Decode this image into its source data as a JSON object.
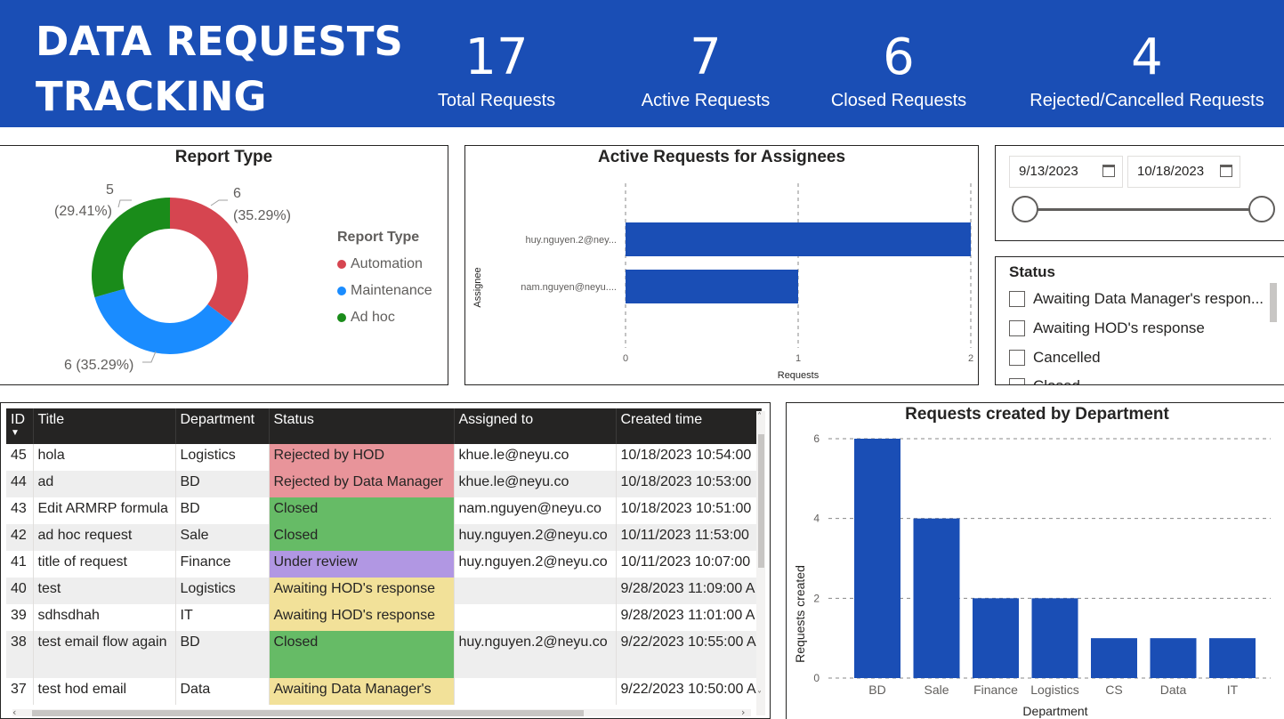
{
  "header": {
    "title_line1": "DATA REQUESTS",
    "title_line2": "TRACKING",
    "bg_color": "#1A4EB5",
    "kpis": [
      {
        "value": "17",
        "label": "Total Requests"
      },
      {
        "value": "7",
        "label": "Active Requests"
      },
      {
        "value": "6",
        "label": "Closed Requests"
      },
      {
        "value": "4",
        "label": "Rejected/Cancelled Requests"
      }
    ]
  },
  "report_type": {
    "title": "Report Type",
    "legend_title": "Report Type",
    "legend": [
      {
        "label": "Automation",
        "color": "#D64550"
      },
      {
        "label": "Maintenance",
        "color": "#1A8CFF"
      },
      {
        "label": "Ad hoc",
        "color": "#1A8C1A"
      }
    ],
    "callouts": {
      "automation_count": "6",
      "automation_pct": "(35.29%)",
      "maintenance": "6 (35.29%)",
      "adhoc_count": "5",
      "adhoc_pct": "(29.41%)"
    }
  },
  "assignees_chart": {
    "title": "Active Requests for Assignees",
    "ylabel": "Assignee",
    "xlabel": "Requests"
  },
  "date_slicer": {
    "start": "9/13/2023",
    "end": "10/18/2023",
    "icon": "calendar-icon"
  },
  "status_slicer": {
    "title": "Status",
    "items": [
      "Awaiting Data Manager's respon...",
      "Awaiting HOD's response",
      "Cancelled",
      "Closed"
    ]
  },
  "table": {
    "columns": [
      "ID",
      "Title",
      "Department",
      "Status",
      "Assigned to",
      "Created time"
    ],
    "rows": [
      {
        "id": "45",
        "title": "hola",
        "dept": "Logistics",
        "status": "Rejected by HOD",
        "status_color": "#E8949A",
        "assigned": "khue.le@neyu.co",
        "created": "10/18/2023 10:54:00"
      },
      {
        "id": "44",
        "title": "ad",
        "dept": "BD",
        "status": "Rejected by Data Manager",
        "status_color": "#E8949A",
        "assigned": "khue.le@neyu.co",
        "created": "10/18/2023 10:53:00"
      },
      {
        "id": "43",
        "title": "Edit ARMRP formula",
        "dept": "BD",
        "status": "Closed",
        "status_color": "#66BB66",
        "assigned": "nam.nguyen@neyu.co",
        "created": "10/18/2023 10:51:00"
      },
      {
        "id": "42",
        "title": "ad hoc request",
        "dept": "Sale",
        "status": "Closed",
        "status_color": "#66BB66",
        "assigned": "huy.nguyen.2@neyu.co",
        "created": "10/11/2023 11:53:00"
      },
      {
        "id": "41",
        "title": "title of request",
        "dept": "Finance",
        "status": "Under review",
        "status_color": "#B197E3",
        "assigned": "huy.nguyen.2@neyu.co",
        "created": "10/11/2023 10:07:00"
      },
      {
        "id": "40",
        "title": "test",
        "dept": "Logistics",
        "status": "Awaiting HOD's response",
        "status_color": "#F2E199",
        "assigned": "",
        "created": "9/28/2023 11:09:00 A"
      },
      {
        "id": "39",
        "title": "sdhsdhah",
        "dept": "IT",
        "status": "Awaiting HOD's response",
        "status_color": "#F2E199",
        "assigned": "",
        "created": "9/28/2023 11:01:00 A"
      },
      {
        "id": "38",
        "title": "test email flow again",
        "dept": "BD",
        "status": "Closed",
        "status_color": "#66BB66",
        "assigned": "huy.nguyen.2@neyu.co",
        "created": "9/22/2023 10:55:00 A"
      },
      {
        "id": "37",
        "title": "test hod email",
        "dept": "Data",
        "status": "Awaiting Data Manager's",
        "status_color": "#F2E199",
        "assigned": "",
        "created": "9/22/2023 10:50:00 A"
      }
    ]
  },
  "dept_chart": {
    "title": "Requests created by Department"
  },
  "chart_data": [
    {
      "type": "pie",
      "title": "Report Type",
      "categories": [
        "Automation",
        "Maintenance",
        "Ad hoc"
      ],
      "values": [
        6,
        6,
        5
      ],
      "colors": [
        "#D64550",
        "#1A8CFF",
        "#1A8C1A"
      ],
      "donut": true,
      "legend": "right"
    },
    {
      "type": "bar",
      "orientation": "horizontal",
      "title": "Active Requests for Assignees",
      "categories": [
        "huy.nguyen.2@ney...",
        "nam.nguyen@neyu...."
      ],
      "values": [
        2,
        1
      ],
      "xlabel": "Requests",
      "ylabel": "Assignee",
      "xlim": [
        0,
        2
      ],
      "xticks": [
        "0",
        "1",
        "2"
      ],
      "color": "#1A4EB5",
      "grid": true
    },
    {
      "type": "bar",
      "title": "Requests created by Department",
      "categories": [
        "BD",
        "Sale",
        "Finance",
        "Logistics",
        "CS",
        "Data",
        "IT"
      ],
      "values": [
        6,
        4,
        2,
        2,
        1,
        1,
        1
      ],
      "xlabel": "Department",
      "ylabel": "Requests created",
      "ylim": [
        0,
        6
      ],
      "yticks": [
        "0",
        "2",
        "4",
        "6"
      ],
      "color": "#1A4EB5",
      "grid": true
    }
  ]
}
